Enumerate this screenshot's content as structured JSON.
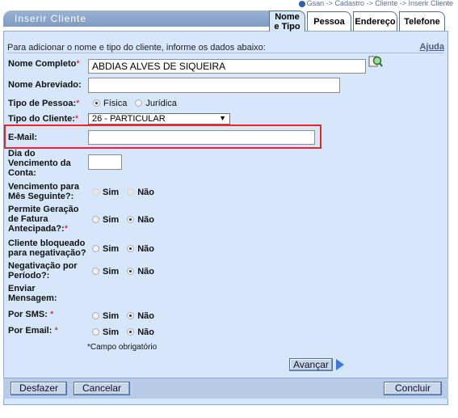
{
  "breadcrumb": "Gsan -> Cadastro -> Cliente -> Inserir Cliente",
  "window_title": "Inserir Cliente",
  "tabs": [
    {
      "label": "Nome e Tipo",
      "active": true
    },
    {
      "label": "Pessoa",
      "active": false
    },
    {
      "label": "Endereço",
      "active": false
    },
    {
      "label": "Telefone",
      "active": false
    }
  ],
  "intro": "Para adicionar o nome e tipo do cliente, informe os dados abaixo:",
  "help_link": "Ajuda",
  "fields": {
    "nome_completo": {
      "label": "Nome Completo",
      "required": "*",
      "value": "ABDIAS ALVES DE SIQUEIRA"
    },
    "nome_abreviado": {
      "label": "Nome Abreviado:",
      "value": ""
    },
    "tipo_pessoa": {
      "label": "Tipo de Pessoa:",
      "required": "*",
      "options": [
        "Física",
        "Jurídica"
      ],
      "selected": "Física"
    },
    "tipo_cliente": {
      "label": "Tipo do Cliente:",
      "required": "*",
      "value": "26 - PARTICULAR"
    },
    "email": {
      "label": "E-Mail:",
      "value": ""
    },
    "dia_vencimento": {
      "label": "Dia do Vencimento da Conta:",
      "value": ""
    },
    "vencimento_mes_seguinte": {
      "label": "Vencimento para Mês Seguinte?:",
      "options": [
        "Sim",
        "Não"
      ],
      "selected": null
    },
    "geracao_fatura": {
      "label": "Permite Geração de Fatura Antecipada?:",
      "required": "*",
      "options": [
        "Sim",
        "Não"
      ],
      "selected": "Não"
    },
    "bloqueado_negativacao": {
      "label": "Cliente bloqueado para negativação?",
      "options": [
        "Sim",
        "Não"
      ],
      "selected": "Não"
    },
    "negativacao_periodo": {
      "label": "Negativação por Período?:",
      "options": [
        "Sim",
        "Não"
      ],
      "selected": "Não"
    },
    "enviar_mensagem": {
      "label": "Enviar Mensagem:"
    },
    "por_sms": {
      "label": "Por SMS:",
      "required": "*",
      "options": [
        "Sim",
        "Não"
      ],
      "selected": "Não"
    },
    "por_email": {
      "label": "Por Email:",
      "required": "*",
      "options": [
        "Sim",
        "Não"
      ],
      "selected": "Não"
    }
  },
  "required_note": "*Campo obrigatório",
  "buttons": {
    "avancar": "Avançar",
    "desfazer": "Desfazer",
    "cancelar": "Cancelar",
    "concluir": "Concluir"
  },
  "icons": {
    "breadcrumb": "info-dot-icon",
    "search": "magnifier-icon",
    "next": "arrow-right-icon",
    "dropdown": "chevron-down-icon"
  },
  "colors": {
    "panel": "#d6e6fb",
    "highlight": "#e32626",
    "tab_border": "#4f6fa0",
    "footer": "#b7cbe6"
  }
}
